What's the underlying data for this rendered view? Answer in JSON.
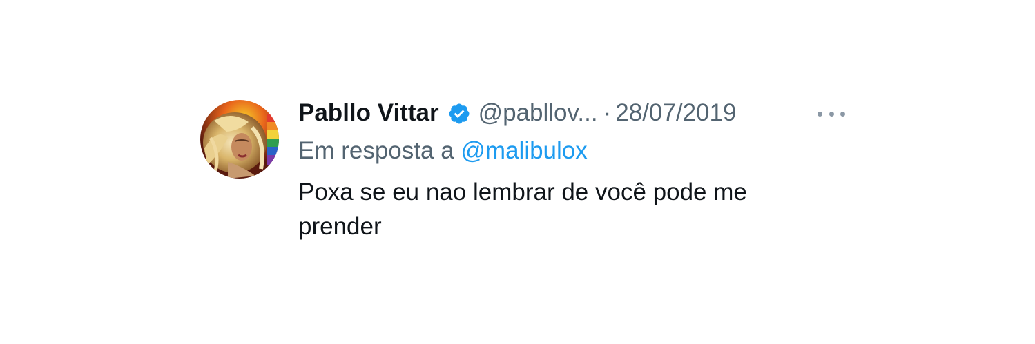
{
  "tweet": {
    "display_name": "Pabllo Vittar",
    "verified": true,
    "handle": "@pabllov...",
    "separator": "·",
    "date": "28/07/2019",
    "reply_prefix": "Em resposta a",
    "reply_to": "@malibulox",
    "text": "Poxa se eu nao lembrar de você pode me prender",
    "avatar": "profile-photo",
    "more_icon": "more-horizontal-icon"
  },
  "colors": {
    "name": "#0f1419",
    "secondary": "#536471",
    "link": "#1d9bf0",
    "verified": "#1d9bf0",
    "more_dots": "#8b98a5",
    "background": "#ffffff"
  }
}
